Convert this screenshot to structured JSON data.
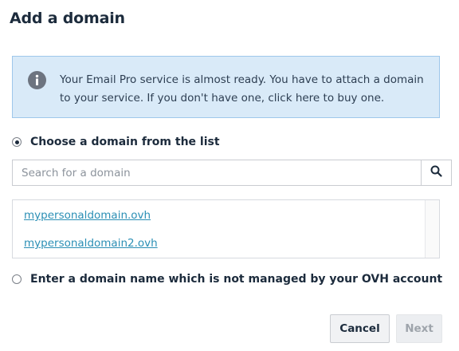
{
  "dialog": {
    "title": "Add a domain"
  },
  "info": {
    "icon": "info-icon",
    "text_before": "Your Email Pro service is almost ready. You have to attach a domain to your service. If you don't have one, ",
    "link": "click here",
    "text_after": " to buy one."
  },
  "options": {
    "list_label": "Choose a domain from the list",
    "list_selected": true,
    "external_label": "Enter a domain name which is not managed by your OVH account",
    "external_selected": false
  },
  "search": {
    "placeholder": "Search for a domain",
    "value": "",
    "icon": "search-icon"
  },
  "domains": [
    "mypersonaldomain.ovh",
    "mypersonaldomain2.ovh"
  ],
  "buttons": {
    "cancel": "Cancel",
    "next": "Next"
  },
  "colors": {
    "info_bg": "#d9eaf8",
    "info_border": "#9ec7eb",
    "link": "#2b8fb5",
    "heading": "#1c2b3c"
  }
}
